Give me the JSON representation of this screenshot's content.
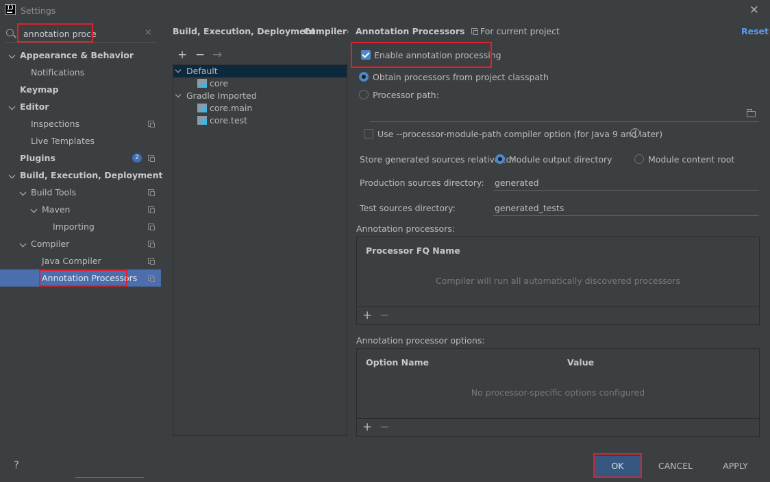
{
  "window": {
    "title": "Settings",
    "logo_text": "IJ"
  },
  "search": {
    "value": "annotation proce",
    "clear": "×"
  },
  "sidebar": {
    "items": [
      {
        "label": "Appearance & Behavior",
        "bold": true
      },
      {
        "label": "Notifications"
      },
      {
        "label": "Keymap",
        "bold": true
      },
      {
        "label": "Editor",
        "bold": true
      },
      {
        "label": "Inspections"
      },
      {
        "label": "Live Templates"
      },
      {
        "label": "Plugins",
        "bold": true,
        "badge": "2"
      },
      {
        "label": "Build, Execution, Deployment",
        "bold": true
      },
      {
        "label": "Build Tools"
      },
      {
        "label": "Maven"
      },
      {
        "label": "Importing"
      },
      {
        "label": "Compiler"
      },
      {
        "label": "Java Compiler"
      },
      {
        "label": "Annotation Processors",
        "selected": true
      }
    ]
  },
  "breadcrumb": {
    "items": [
      "Build, Execution, Deployment",
      "Compiler",
      "Annotation Processors"
    ],
    "separator": "›",
    "scope": "For current project",
    "reset": "Reset"
  },
  "profiles": {
    "toolbar": {
      "add": "+",
      "remove": "−",
      "move": "→"
    },
    "items": [
      {
        "label": "Default"
      },
      {
        "label": "core"
      },
      {
        "label": "Gradle Imported"
      },
      {
        "label": "core.main"
      },
      {
        "label": "core.test"
      }
    ]
  },
  "config": {
    "enable_label": "Enable annotation processing",
    "obtain_label": "Obtain processors from project classpath",
    "processor_path_label": "Processor path:",
    "module_path_label": "Use --processor-module-path compiler option (for Java 9 and later)",
    "store_label": "Store generated sources relative to:",
    "module_output_label": "Module output directory",
    "module_content_label": "Module content root",
    "production_label": "Production sources directory:",
    "production_value": "generated",
    "test_label": "Test sources directory:",
    "test_value": "generated_tests",
    "help": "?"
  },
  "processors_table": {
    "section_label": "Annotation processors:",
    "column": "Processor FQ Name",
    "empty": "Compiler will run all automatically discovered processors",
    "add": "+",
    "remove": "−"
  },
  "options_table": {
    "section_label": "Annotation processor options:",
    "col_name": "Option Name",
    "col_value": "Value",
    "empty": "No processor-specific options configured",
    "add": "+",
    "remove": "−"
  },
  "footer": {
    "help": "?",
    "ok": "OK",
    "cancel": "CANCEL",
    "apply": "APPLY"
  },
  "colors": {
    "selection": "#4b6eaf",
    "highlight": "#e0202b",
    "link": "#589df6",
    "primary_button": "#365880"
  }
}
